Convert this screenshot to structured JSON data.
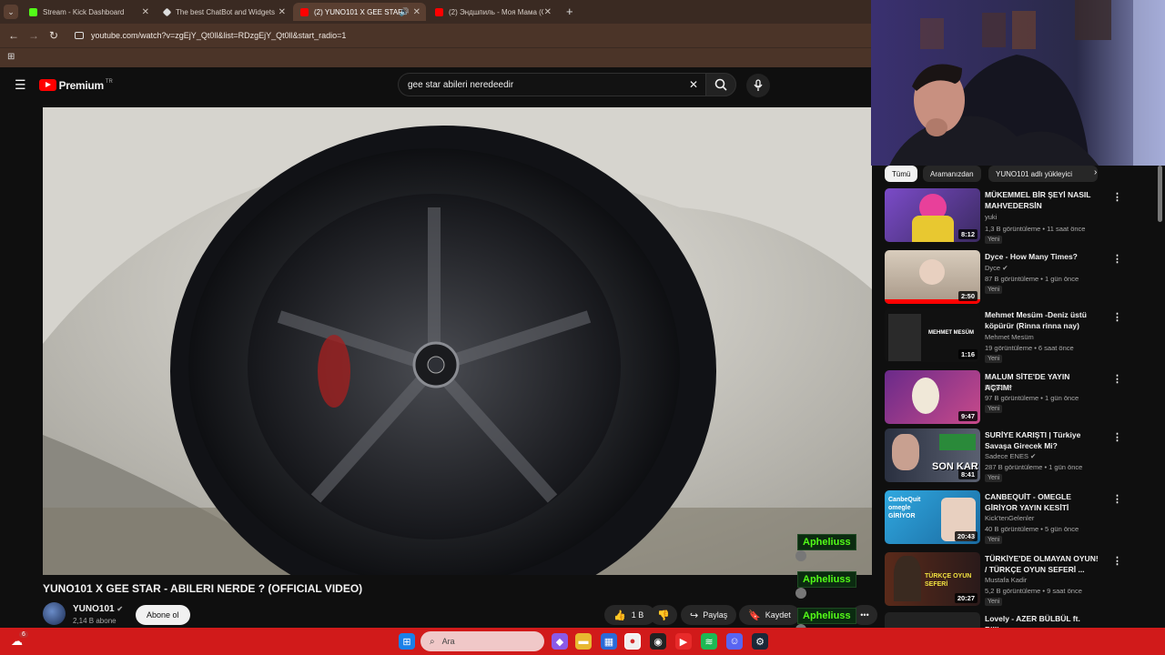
{
  "browser": {
    "tabs": [
      {
        "title": "Stream - Kick Dashboard",
        "active": false
      },
      {
        "title": "The best ChatBot and Widgets",
        "active": false
      },
      {
        "title": "(2) YUNO101 X GEE STAR -",
        "active": true
      },
      {
        "title": "(2) Эндшпиль - Моя Мама (Of",
        "active": false
      }
    ],
    "url": "youtube.com/watch?v=zgEjY_Qt0ll&list=RDzgEjY_Qt0ll&start_radio=1"
  },
  "youtube": {
    "brand": "Premium",
    "region": "TR",
    "search_query": "gee star abileri neredeedir"
  },
  "video": {
    "title": "YUNO101 X GEE STAR - ABILERI NERDE ? (OFFICIAL VIDEO)",
    "channel": "YUNO101",
    "subscribers": "2,14 B abone",
    "subscribe_label": "Abone ol",
    "likes": "1 B",
    "share_label": "Paylaş",
    "save_label": "Kaydet",
    "more_label": "•••"
  },
  "chips": [
    "Tümü",
    "Aramanızdan",
    "YUNO101 adlı yükleyici"
  ],
  "recommendations": [
    {
      "title": "MÜKEMMEL BİR ŞEYİ NASIL MAHVEDERSİN",
      "channel": "yuki",
      "meta": "1,3 B görüntüleme • 11 saat önce",
      "badge": "Yeni",
      "duration": "8:12",
      "thumb_color": "#6a3fb0"
    },
    {
      "title": "Dyce - How Many Times?",
      "channel": "Dyce",
      "meta": "87 B görüntüleme • 1 gün önce",
      "badge": "Yeni",
      "duration": "2:50",
      "thumb_color": "#c9b9a8"
    },
    {
      "title": "Mehmet Mesüm -Deniz üstü köpürür (Rinna rinna nay)",
      "channel": "Mehmet Mesüm",
      "meta": "19 görüntüleme • 6 saat önce",
      "badge": "Yeni",
      "duration": "1:16",
      "thumb_color": "#111111",
      "thumb_text": "MEHMET MESÜM"
    },
    {
      "title": "MALUM SİTE'DE YAYIN AÇTIM!",
      "channel": "Misyoner",
      "meta": "97 B görüntüleme • 1 gün önce",
      "badge": "Yeni",
      "duration": "9:47",
      "thumb_color": "#5a2a7a"
    },
    {
      "title": "SURİYE KARIŞTI | Türkiye Savaşa Girecek Mi?",
      "channel": "Sadece ENES",
      "meta": "287 B görüntüleme • 1 gün önce",
      "badge": "Yeni",
      "duration": "8:41",
      "thumb_color": "#3a4a5a",
      "thumb_text": "SON KAR"
    },
    {
      "title": "CANBEQUİT - OMEGLE GİRİYOR YAYIN KESİTİ",
      "channel": "Kick'tenGelenler",
      "meta": "40 B görüntüleme • 5 gün önce",
      "badge": "Yeni",
      "duration": "20:43",
      "thumb_color": "#2a9ad0",
      "thumb_text": "CanbeQuit omegle GİRİYOR"
    },
    {
      "title": "TÜRKİYE'DE OLMAYAN OYUN! / TÜRKÇE OYUN SEFERİ ...",
      "channel": "Mustafa Kadir",
      "meta": "5,2 B görüntüleme • 9 saat önce",
      "badge": "Yeni",
      "duration": "20:27",
      "thumb_color": "#7a3a2a",
      "thumb_text": "TÜRKÇE OYUN SEFERİ"
    },
    {
      "title": "Lovely - AZER BÜLBÜL ft. Billie",
      "channel": "",
      "meta": "",
      "badge": "",
      "duration": "",
      "thumb_color": "#222222"
    }
  ],
  "chat": [
    {
      "name": "Apheliuss"
    },
    {
      "name": "Apheliuss"
    },
    {
      "name": "Apheliuss"
    }
  ],
  "taskbar": {
    "search_placeholder": "Ara",
    "notif_count": "6"
  },
  "colors": {
    "youtube_red": "#ff0000",
    "kick_green": "#53fc18",
    "taskbar_red": "#d11a1a",
    "browser_brown": "#4b3428"
  }
}
